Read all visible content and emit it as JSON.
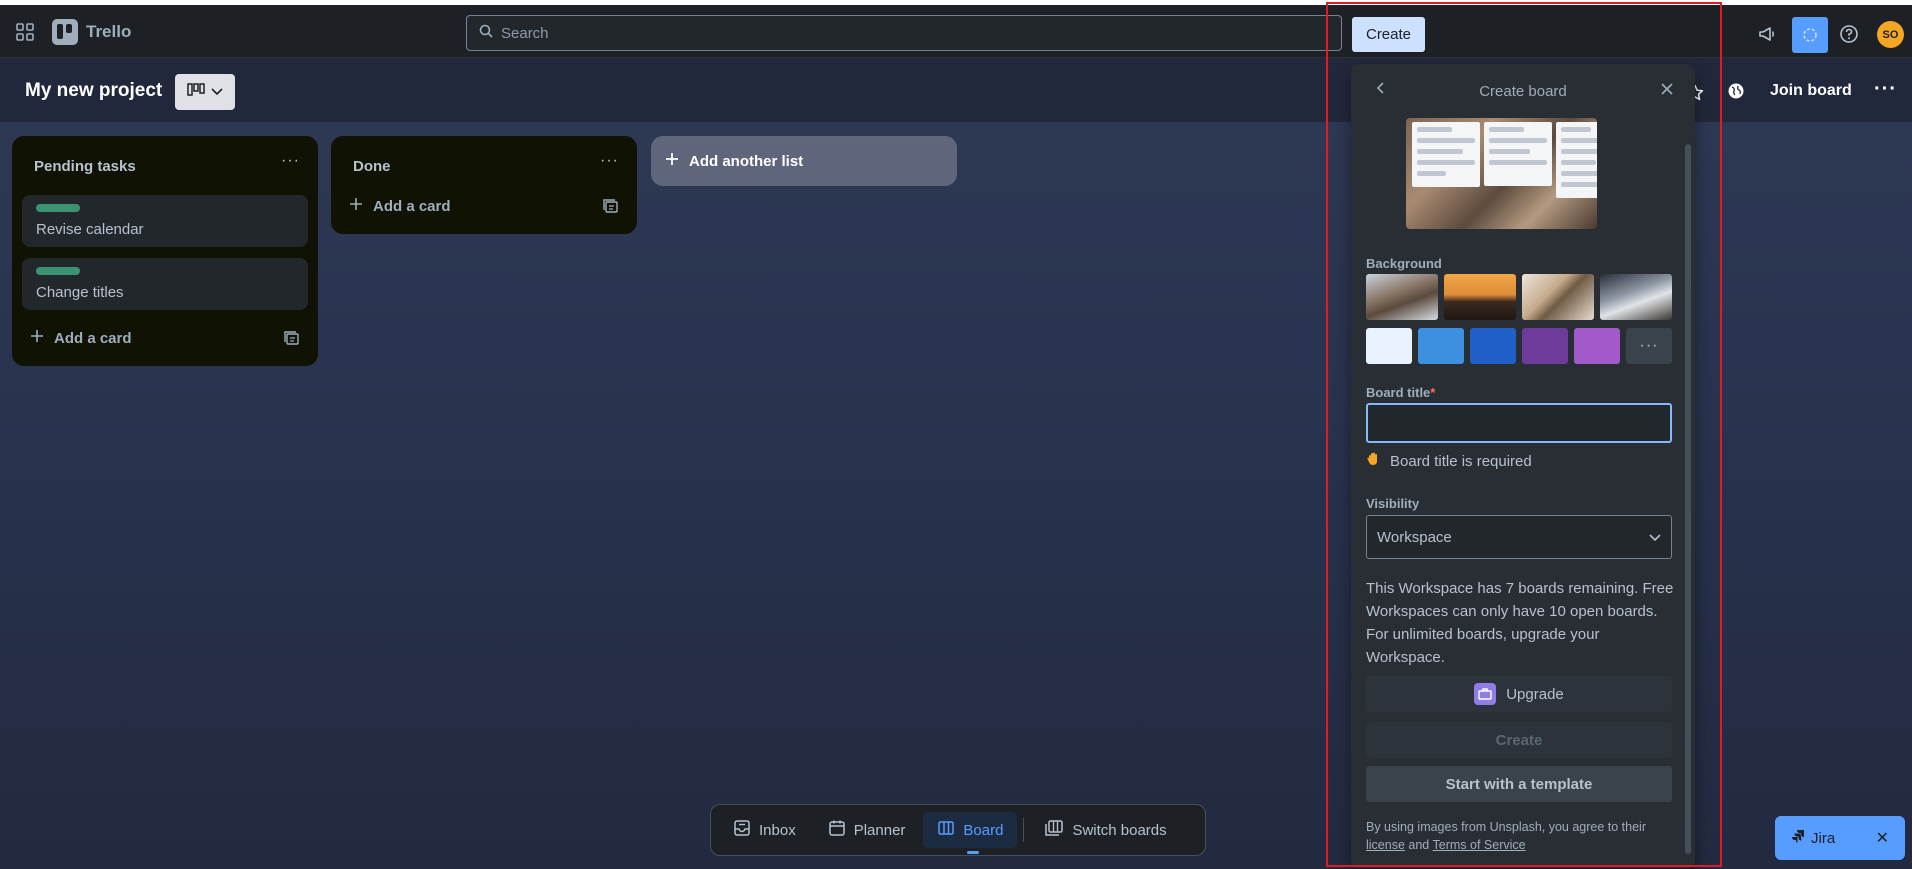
{
  "topbar": {
    "app_name": "Trello",
    "search_placeholder": "Search",
    "create_label": "Create",
    "avatar_initials": "SO"
  },
  "board": {
    "title": "My new project",
    "join_label": "Join board",
    "more_label": "···"
  },
  "lists": [
    {
      "title": "Pending tasks",
      "menu": "···",
      "cards": [
        {
          "text": "Revise calendar",
          "label_color": "#4bce97"
        },
        {
          "text": "Change titles",
          "label_color": "#4bce97"
        }
      ],
      "add_card": "Add a card"
    },
    {
      "title": "Done",
      "menu": "···",
      "cards": [],
      "add_card": "Add a card"
    }
  ],
  "add_list_label": "Add another list",
  "bottom_nav": {
    "items": [
      {
        "label": "Inbox",
        "icon": "inbox-icon"
      },
      {
        "label": "Planner",
        "icon": "calendar-icon"
      },
      {
        "label": "Board",
        "icon": "board-icon",
        "active": true
      },
      {
        "label": "Switch boards",
        "icon": "switch-boards-icon"
      }
    ]
  },
  "jira": {
    "label": "Jira"
  },
  "create_board": {
    "title": "Create board",
    "background_label": "Background",
    "board_title_label": "Board title",
    "required_mark": "*",
    "title_value": "",
    "required_message": "Board title is required",
    "visibility_label": "Visibility",
    "visibility_value": "Workspace",
    "workspace_note": "This Workspace has 7 boards remaining. Free Workspaces can only have 10 open boards. For unlimited boards, upgrade your Workspace.",
    "upgrade_label": "Upgrade",
    "create_label": "Create",
    "template_label": "Start with a template",
    "unsplash_prefix": "By using images from Unsplash, you agree to their",
    "license_label": "license",
    "and_text": "and",
    "terms_label": "Terms of Service",
    "more_backgrounds": "···",
    "colors": [
      "#e9f2ff",
      "#3d8fe0",
      "#1f5fc7",
      "#6e3b9b",
      "#a259c9"
    ],
    "accent": "#579dff"
  }
}
